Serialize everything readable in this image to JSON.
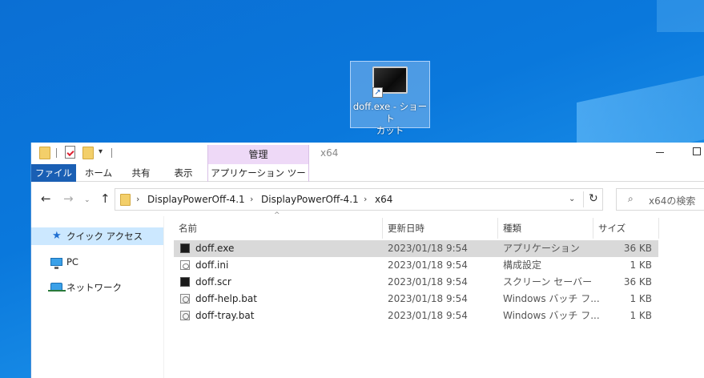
{
  "desktop": {
    "shortcut_label_line1": "doff.exe - ショート",
    "shortcut_label_line2": "カット"
  },
  "window": {
    "title": "x64",
    "context_tab_group": "管理"
  },
  "ribbon": {
    "tabs": [
      "ファイル",
      "ホーム",
      "共有",
      "表示",
      "アプリケーション ツール"
    ]
  },
  "address": {
    "segments": [
      "DisplayPowerOff-4.1",
      "DisplayPowerOff-4.1",
      "x64"
    ]
  },
  "search": {
    "placeholder": "x64の検索"
  },
  "nav_pane": {
    "items": [
      "クイック アクセス",
      "PC",
      "ネットワーク"
    ]
  },
  "columns": {
    "name": "名前",
    "date": "更新日時",
    "type": "種類",
    "size": "サイズ"
  },
  "files": [
    {
      "name": "doff.exe",
      "date": "2023/01/18 9:54",
      "type": "アプリケーション",
      "size": "36 KB",
      "icon": "exe-icon"
    },
    {
      "name": "doff.ini",
      "date": "2023/01/18 9:54",
      "type": "構成設定",
      "size": "1 KB",
      "icon": "ini-icon"
    },
    {
      "name": "doff.scr",
      "date": "2023/01/18 9:54",
      "type": "スクリーン セーバー",
      "size": "36 KB",
      "icon": "scr-icon"
    },
    {
      "name": "doff-help.bat",
      "date": "2023/01/18 9:54",
      "type": "Windows バッチ フ...",
      "size": "1 KB",
      "icon": "bat-icon"
    },
    {
      "name": "doff-tray.bat",
      "date": "2023/01/18 9:54",
      "type": "Windows バッチ フ...",
      "size": "1 KB",
      "icon": "bat-icon"
    }
  ],
  "colors": {
    "desktop_blue": "#0a78dc",
    "file_tab": "#1a5fb4",
    "context_tab": "#eed9f7",
    "selected_row": "#d9d9d9",
    "nav_active": "#cce8ff"
  }
}
